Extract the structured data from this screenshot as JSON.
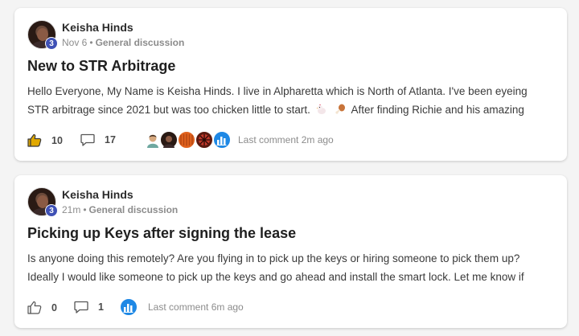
{
  "posts": [
    {
      "author": "Keisha Hinds",
      "level": "3",
      "time": "Nov 6",
      "separator": "•",
      "category": "General discussion",
      "title": "New to STR Arbitrage",
      "body_line1": "Hello Everyone, My Name is Keisha Hinds. I live in Alpharetta which is North of Atlanta. I've been eyeing",
      "body_line2_a": "STR arbitrage since 2021 but was too chicken little to start.",
      "body_line2_b": "After finding Richie and his amazing",
      "likes": "10",
      "comments": "17",
      "last_comment": "Last comment 2m ago",
      "commenter_avatars": [
        "person-avatar",
        "dark-avatar",
        "orange-avatar",
        "red-pattern-avatar",
        "chart-logo-avatar"
      ]
    },
    {
      "author": "Keisha Hinds",
      "level": "3",
      "time": "21m",
      "separator": "•",
      "category": "General discussion",
      "title": "Picking up Keys after signing the lease",
      "body_line1": "Is anyone doing this remotely? Are you flying in to pick up the keys or hiring someone to pick them up?",
      "body_line2": "Ideally I would like someone to pick up the keys and go ahead and install the smart lock. Let me know if",
      "likes": "0",
      "comments": "1",
      "last_comment": "Last comment 6m ago",
      "commenter_avatars": [
        "chart-logo-avatar"
      ]
    }
  ],
  "colors": {
    "badge": "#3f51b5",
    "like_icon": "#e0a800",
    "logo_avatar": "#1e88e5"
  }
}
